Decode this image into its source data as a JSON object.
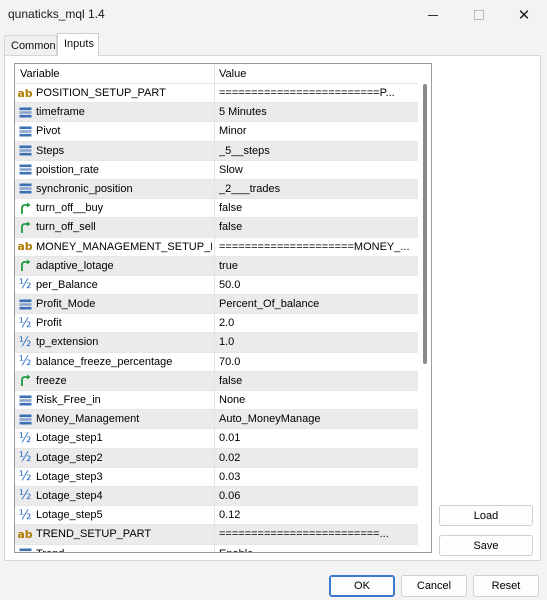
{
  "window": {
    "title": "qunaticks_mql 1.4",
    "close_glyph": "✕"
  },
  "tabs": [
    {
      "label": "Common"
    },
    {
      "label": "Inputs"
    }
  ],
  "grid": {
    "headers": {
      "variable": "Variable",
      "value": "Value"
    },
    "rows": [
      {
        "type": "string",
        "name": "POSITION_SETUP_PART",
        "value": "=========================P..."
      },
      {
        "type": "enum",
        "name": "timeframe",
        "value": "5 Minutes"
      },
      {
        "type": "enum",
        "name": "Pivot",
        "value": "Minor"
      },
      {
        "type": "enum",
        "name": "Steps",
        "value": "_5__steps"
      },
      {
        "type": "enum",
        "name": "poistion_rate",
        "value": "Slow"
      },
      {
        "type": "enum",
        "name": "synchronic_position",
        "value": "_2___trades"
      },
      {
        "type": "bool",
        "name": "turn_off__buy",
        "value": "false"
      },
      {
        "type": "bool",
        "name": "turn_off_sell",
        "value": "false"
      },
      {
        "type": "string",
        "name": "MONEY_MANAGEMENT_SETUP_PART",
        "value": "=====================MONEY_..."
      },
      {
        "type": "bool",
        "name": "adaptive_lotage",
        "value": "true"
      },
      {
        "type": "double",
        "name": "per_Balance",
        "value": "50.0"
      },
      {
        "type": "enum",
        "name": "Profit_Mode",
        "value": "Percent_Of_balance"
      },
      {
        "type": "double",
        "name": "Profit",
        "value": "2.0"
      },
      {
        "type": "double",
        "name": "tp_extension",
        "value": "1.0"
      },
      {
        "type": "double",
        "name": "balance_freeze_percentage",
        "value": "70.0"
      },
      {
        "type": "bool",
        "name": "freeze",
        "value": "false"
      },
      {
        "type": "enum",
        "name": "Risk_Free_in",
        "value": "None"
      },
      {
        "type": "enum",
        "name": "Money_Management",
        "value": "Auto_MoneyManage"
      },
      {
        "type": "double",
        "name": "Lotage_step1",
        "value": "0.01"
      },
      {
        "type": "double",
        "name": "Lotage_step2",
        "value": "0.02"
      },
      {
        "type": "double",
        "name": "Lotage_step3",
        "value": "0.03"
      },
      {
        "type": "double",
        "name": "Lotage_step4",
        "value": "0.06"
      },
      {
        "type": "double",
        "name": "Lotage_step5",
        "value": "0.12"
      },
      {
        "type": "string",
        "name": "TREND_SETUP_PART",
        "value": "=========================..."
      },
      {
        "type": "enum",
        "name": "Trend",
        "value": "Enable"
      }
    ]
  },
  "side_buttons": {
    "load": "Load",
    "save": "Save"
  },
  "dialog_buttons": {
    "ok": "OK",
    "cancel": "Cancel",
    "reset": "Reset"
  },
  "icons": {
    "string": {
      "name": "ab-string-icon",
      "glyph": "ab",
      "color": "#b07a00"
    },
    "double": {
      "name": "fraction-double-icon",
      "glyph": "½",
      "color": "#2b6cc4"
    },
    "bool": {
      "name": "green-arrow-bool-icon",
      "color": "#1f9a3c"
    },
    "enum": {
      "name": "list-enum-icon",
      "color": "#3b6fb6"
    }
  }
}
